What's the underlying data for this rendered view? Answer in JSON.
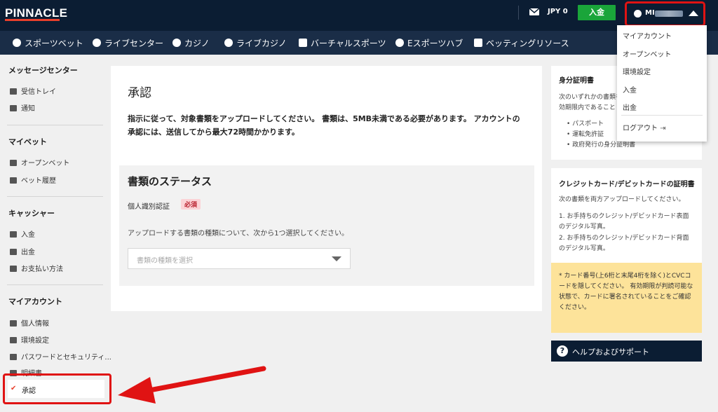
{
  "header": {
    "logo": "PINNACLE",
    "currency": "JPY 0",
    "deposit_label": "入金",
    "user_name": "MI"
  },
  "nav": {
    "items": [
      {
        "label": "スポーツベット",
        "icon": "soccer-ball-icon"
      },
      {
        "label": "ライブセンター",
        "icon": "live-icon"
      },
      {
        "label": "カジノ",
        "icon": "casino-icon"
      },
      {
        "label": "ライブカジノ",
        "icon": "chip-icon"
      },
      {
        "label": "バーチャルスポーツ",
        "icon": "virtual-icon"
      },
      {
        "label": "Eスポーツハブ",
        "icon": "headset-icon"
      },
      {
        "label": "ベッティングリソース",
        "icon": "book-icon"
      }
    ]
  },
  "user_menu": {
    "items": [
      "マイアカウント",
      "オープンベット",
      "環境設定",
      "入金",
      "出金"
    ],
    "logout": "ログアウト"
  },
  "sidebar": {
    "sections": [
      {
        "title": "メッセージセンター",
        "items": [
          "受信トレイ",
          "通知"
        ]
      },
      {
        "title": "マイベット",
        "items": [
          "オープンベット",
          "ベット履歴"
        ]
      },
      {
        "title": "キャッシャー",
        "items": [
          "入金",
          "出金",
          "お支払い方法"
        ]
      },
      {
        "title": "マイアカウント",
        "items": [
          "個人情報",
          "環境設定",
          "パスワードとセキュリティ...",
          "明細書",
          "承認"
        ]
      }
    ]
  },
  "main": {
    "title": "承認",
    "instructions": "指示に従って、対象書類をアップロードしてください。 書類は、5MB未満である必要があります。 アカウントの承認には、送信してから最大72時間かかります。",
    "status_title": "書類のステータス",
    "id_label": "個人識別認証",
    "required_badge": "必須",
    "upload_text": "アップロードする書類の種類について、次から1つ選択してください。",
    "select_placeholder": "書類の種類を選択"
  },
  "right": {
    "id_card": {
      "title": "身分証明書",
      "text": "次のいずれかの書類を\n効期限内であること",
      "list": [
        "パスポート",
        "運転免許証",
        "政府発行の身分証明書"
      ]
    },
    "card_proof": {
      "title": "クレジットカード/デビットカードの証明書",
      "text": "次の書類を両方アップロードしてください。",
      "list": [
        "1. お手持ちのクレジット/デビッドカード表面のデジタル写真。",
        "2. お手持ちのクレジット/デビッドカード背面のデジタル写真。"
      ],
      "note": "* カード番号(上6桁と末尾4桁を除く)とCVCコードを隠してください。 有効期限が判読可能な状態で、カードに署名されていることをご確認ください。"
    },
    "help": "ヘルプおよびサポート"
  },
  "colors": {
    "topbar": "#0b1d33",
    "navbar": "#1a2d47",
    "deposit": "#1aa53a",
    "highlight": "#e01313",
    "note_bg": "#fde39a"
  }
}
